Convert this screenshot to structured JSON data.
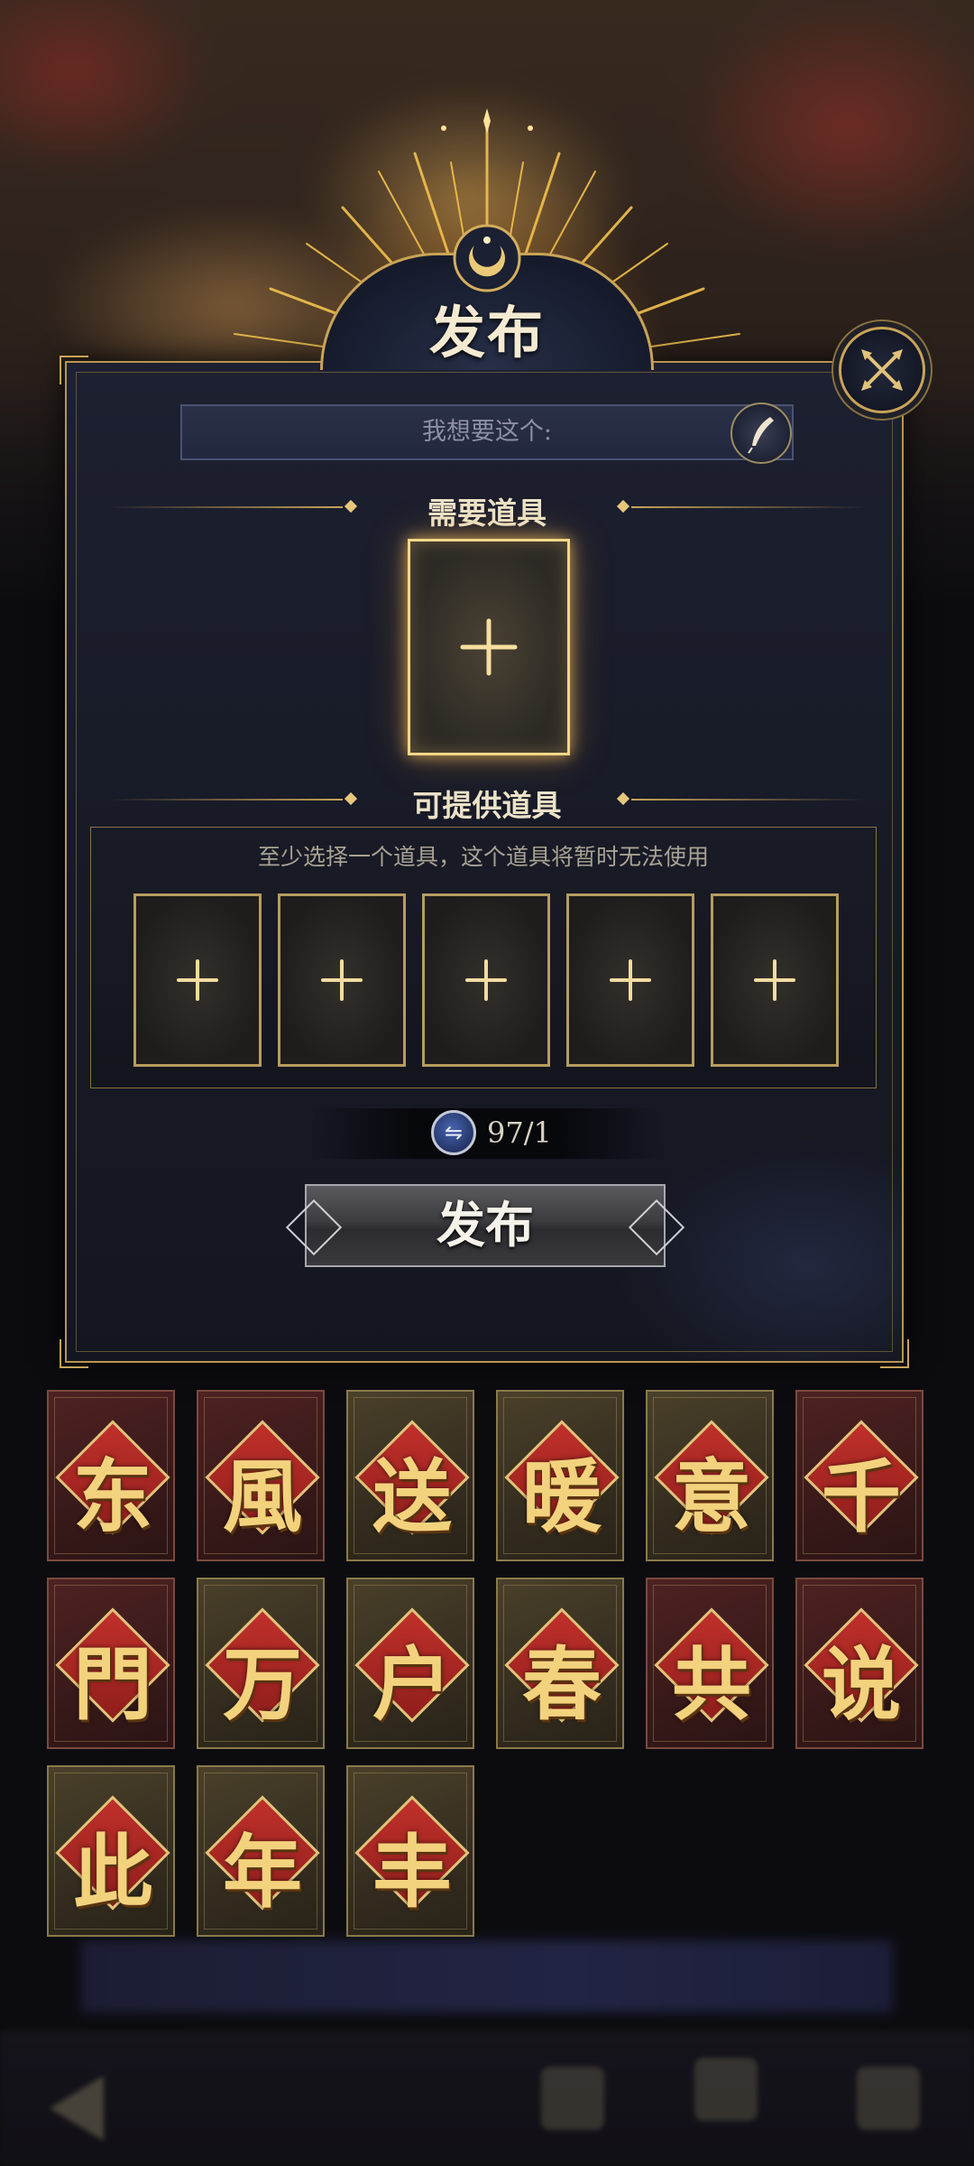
{
  "dialog": {
    "title": "发布",
    "wish_placeholder": "我想要这个:",
    "required_section_label": "需要道具",
    "offer_section_label": "可提供道具",
    "offer_hint": "至少选择一个道具，这个道具将暂时无法使用",
    "offer_slot_count": 5,
    "currency_value": "97/1",
    "publish_label": "发布"
  },
  "cards": [
    {
      "char": "东",
      "style": "red"
    },
    {
      "char": "風",
      "style": "red"
    },
    {
      "char": "送",
      "style": "gold"
    },
    {
      "char": "暖",
      "style": "gold"
    },
    {
      "char": "意",
      "style": "gold"
    },
    {
      "char": "千",
      "style": "red"
    },
    {
      "char": "門",
      "style": "red"
    },
    {
      "char": "万",
      "style": "gold"
    },
    {
      "char": "户",
      "style": "gold"
    },
    {
      "char": "春",
      "style": "gold"
    },
    {
      "char": "共",
      "style": "red"
    },
    {
      "char": "说",
      "style": "red"
    },
    {
      "char": "此",
      "style": "gold"
    },
    {
      "char": "年",
      "style": "gold"
    },
    {
      "char": "丰",
      "style": "gold"
    }
  ],
  "colors": {
    "gold": "#c9a357",
    "panel": "#181b28",
    "card_red": "#4e2222",
    "card_gold": "#4a402a",
    "glyph": "#f3d27d"
  },
  "icons": {
    "close": "close-cross-icon",
    "edit": "quill-pen-icon",
    "currency": "swap-coin-icon",
    "crest": "crescent-moon-icon"
  }
}
